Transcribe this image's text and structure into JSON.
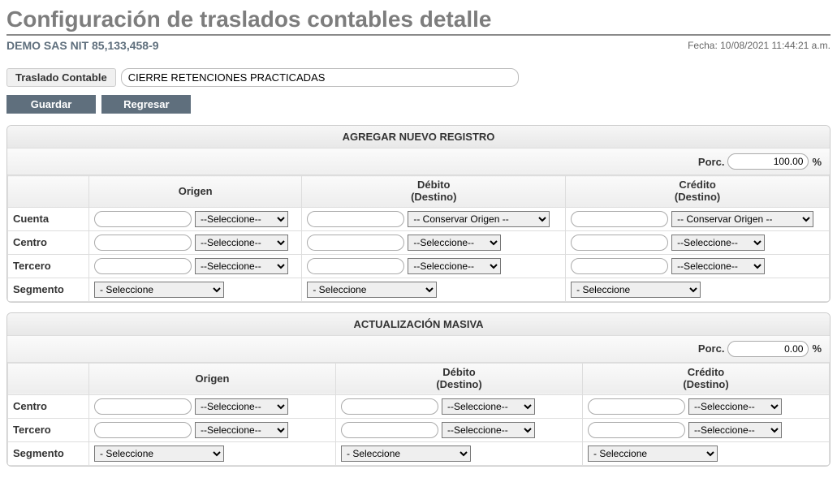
{
  "page_title": "Configuración de traslados contables detalle",
  "company": "DEMO SAS   NIT 85,133,458-9",
  "datetime": "Fecha: 10/08/2021 11:44:21 a.m.",
  "traslado": {
    "label": "Traslado Contable",
    "value": "CIERRE RETENCIONES PRACTICADAS"
  },
  "buttons": {
    "save": "Guardar",
    "back": "Regresar"
  },
  "headers": {
    "origen": "Origen",
    "debito_l1": "Débito",
    "debito_l2": "(Destino)",
    "credito_l1": "Crédito",
    "credito_l2": "(Destino)"
  },
  "rows": {
    "cuenta": "Cuenta",
    "centro": "Centro",
    "tercero": "Tercero",
    "segmento": "Segmento"
  },
  "selects": {
    "seleccione_dashed": "--Seleccione--",
    "seleccione_plain": "- Seleccione",
    "conservar_origen": "-- Conservar Origen --"
  },
  "porc": {
    "label": "Porc.",
    "suffix": "%"
  },
  "section_add": {
    "title": "AGREGAR NUEVO REGISTRO",
    "porc_value": "100.00"
  },
  "section_mass": {
    "title": "ACTUALIZACIÓN MASIVA",
    "porc_value": "0.00"
  }
}
